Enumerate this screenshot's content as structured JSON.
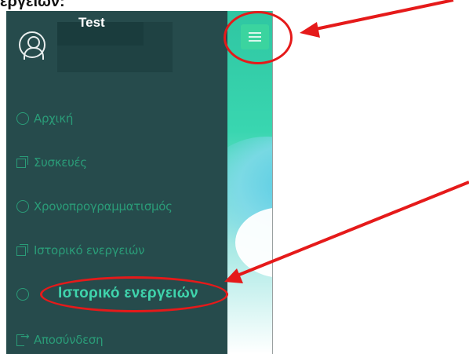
{
  "caption": "εργειών:",
  "user": {
    "name": "Test"
  },
  "nav": {
    "items": [
      {
        "label": "Αρχική",
        "icon": "chart-circle-icon"
      },
      {
        "label": "Συσκευές",
        "icon": "copy-square-icon"
      },
      {
        "label": "Χρονοπρογραμματισμός",
        "icon": "clock-icon"
      },
      {
        "label": "Ιστορικό ενεργειών",
        "icon": "copy-square-icon"
      },
      {
        "label": "Ιστορικό ενεργειών",
        "icon": "user-circle-icon"
      },
      {
        "label": "Αποσύνδεση",
        "icon": "exit-icon"
      }
    ]
  },
  "colors": {
    "sidebar": "#264b4c",
    "nav_text": "#2a9c78",
    "highlight_text": "#3fd4ac",
    "menu_button": "#3bd49f",
    "annotation": "#e51a1a"
  }
}
